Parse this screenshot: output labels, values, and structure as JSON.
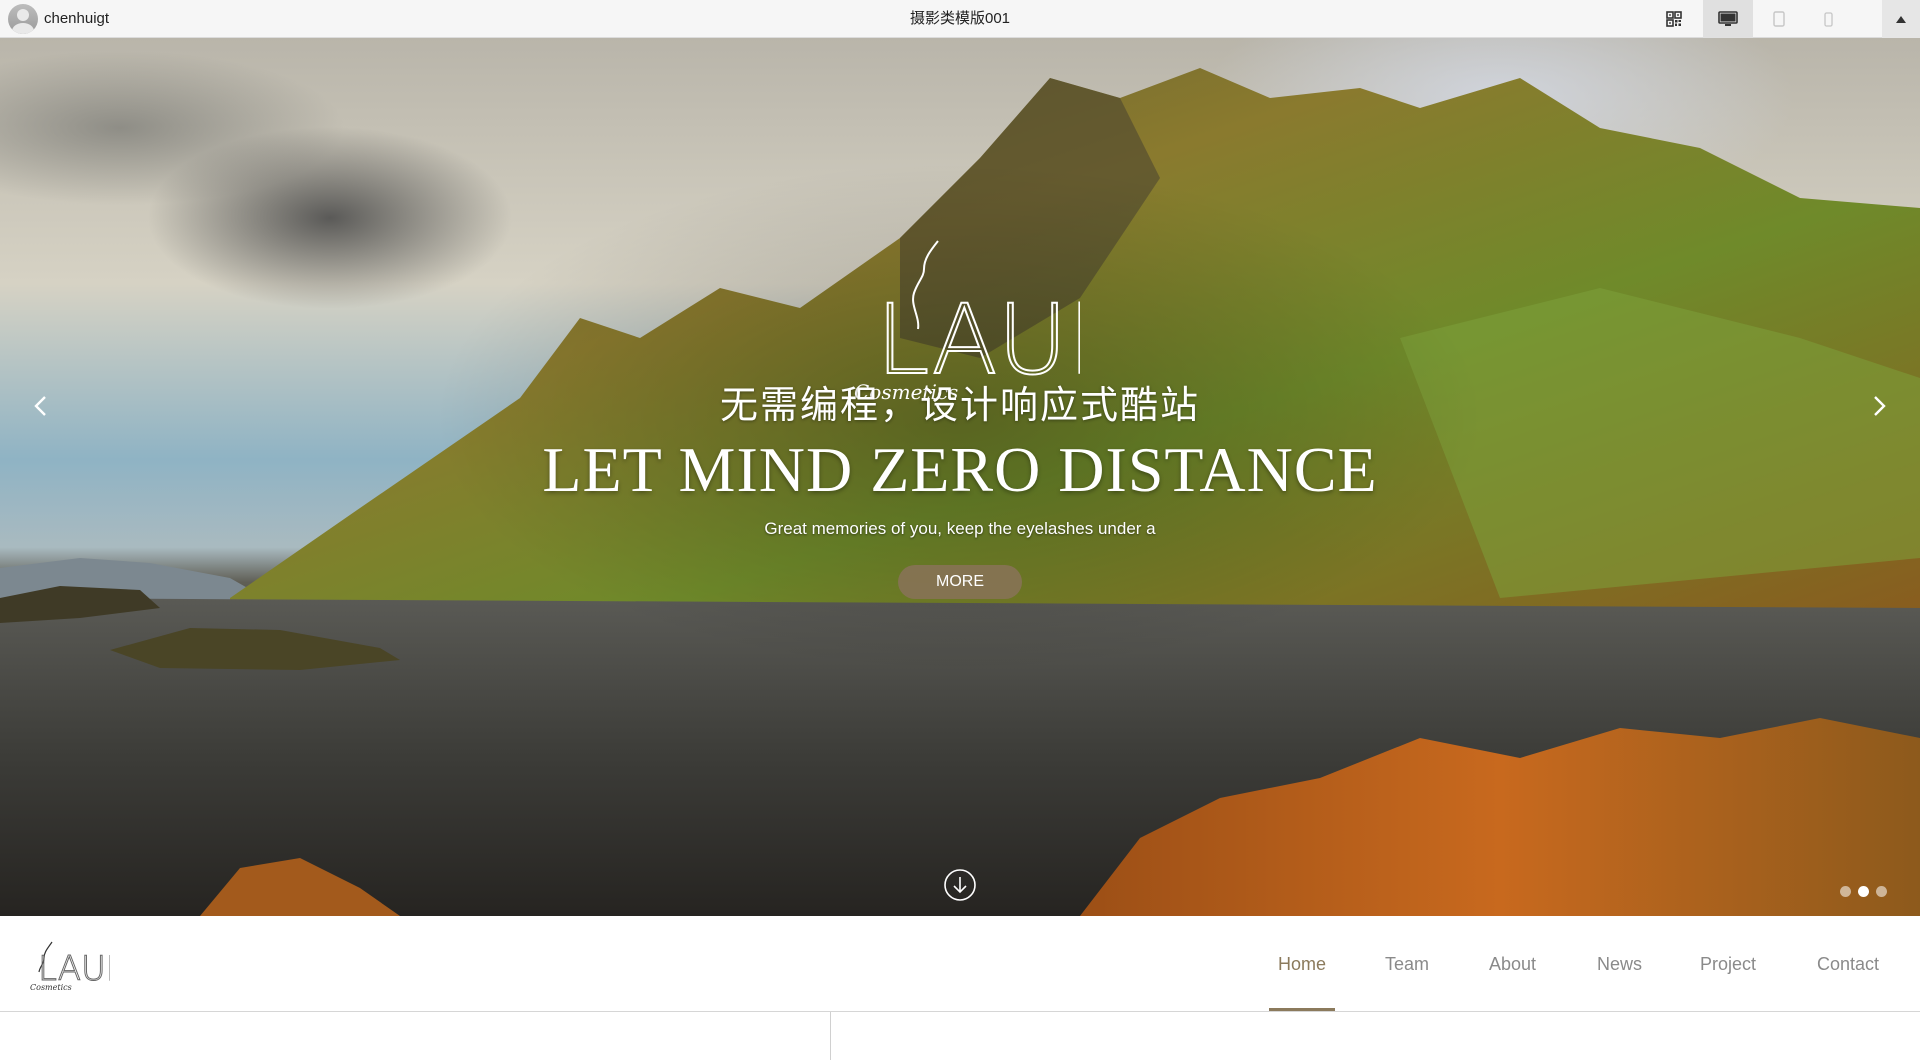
{
  "topbar": {
    "username": "chenhuigt",
    "title": "摄影类模版001"
  },
  "hero": {
    "logo_text": "LAURA",
    "logo_subtext": "Cosmetics",
    "headline_cn": "无需编程，设计响应式酷站",
    "headline_en": "LET MIND ZERO DISTANCE",
    "subtitle": "Great memories of you, keep the eyelashes under a",
    "more_label": "MORE",
    "slide_count": 3,
    "active_slide": 2
  },
  "nav": {
    "logo_text": "LAURA",
    "logo_subtext": "Cosmetics",
    "items": [
      {
        "label": "Home"
      },
      {
        "label": "Team"
      },
      {
        "label": "About"
      },
      {
        "label": "News"
      },
      {
        "label": "Project"
      },
      {
        "label": "Contact"
      }
    ],
    "active_item": "Home"
  },
  "colors": {
    "accent": "#8b7a5c",
    "more_button": "#877355",
    "nav_text": "#8a8a8a"
  },
  "icons": [
    "user-avatar",
    "qr-code-icon",
    "desktop-icon",
    "tablet-icon",
    "mobile-icon",
    "scroll-top-icon",
    "chevron-left-icon",
    "chevron-right-icon",
    "scroll-down-icon"
  ]
}
